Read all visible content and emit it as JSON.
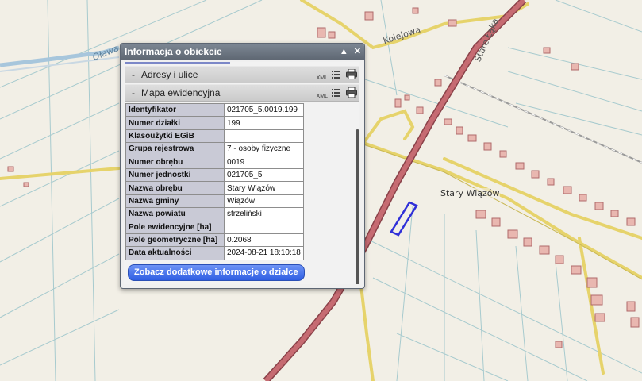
{
  "map": {
    "street_labels": {
      "olawa": "Oława",
      "kolejowa": "Kolejowa",
      "stare": "Stare Łąka",
      "village": "Stary Wiązów"
    }
  },
  "dialog": {
    "title": "Informacja o obiekcie",
    "controls": {
      "collapse": "▲",
      "close": "✕"
    },
    "sections": [
      {
        "toggle": "-",
        "title": "Adresy i ulice",
        "xml": "XML"
      },
      {
        "toggle": "-",
        "title": "Mapa ewidencyjna",
        "xml": "XML"
      }
    ],
    "attributes": [
      {
        "key": "Identyfikator",
        "value": "021705_5.0019.199"
      },
      {
        "key": "Numer działki",
        "value": "199"
      },
      {
        "key": "Klasoużytki EGiB",
        "value": ""
      },
      {
        "key": "Grupa rejestrowa",
        "value": "7 - osoby fizyczne"
      },
      {
        "key": "Numer obrębu",
        "value": "0019"
      },
      {
        "key": "Numer jednostki",
        "value": "021705_5"
      },
      {
        "key": "Nazwa obrębu",
        "value": "Stary Wiązów"
      },
      {
        "key": "Nazwa gminy",
        "value": "Wiązów"
      },
      {
        "key": "Nazwa powiatu",
        "value": "strzeliński"
      },
      {
        "key": "Pole ewidencyjne [ha]",
        "value": ""
      },
      {
        "key": "Pole geometryczne [ha]",
        "value": "0.2068"
      },
      {
        "key": "Data aktualności",
        "value": "2024-08-21 18:10:18"
      }
    ],
    "more_info_button": "Zobacz dodatkowe informacje o działce"
  }
}
